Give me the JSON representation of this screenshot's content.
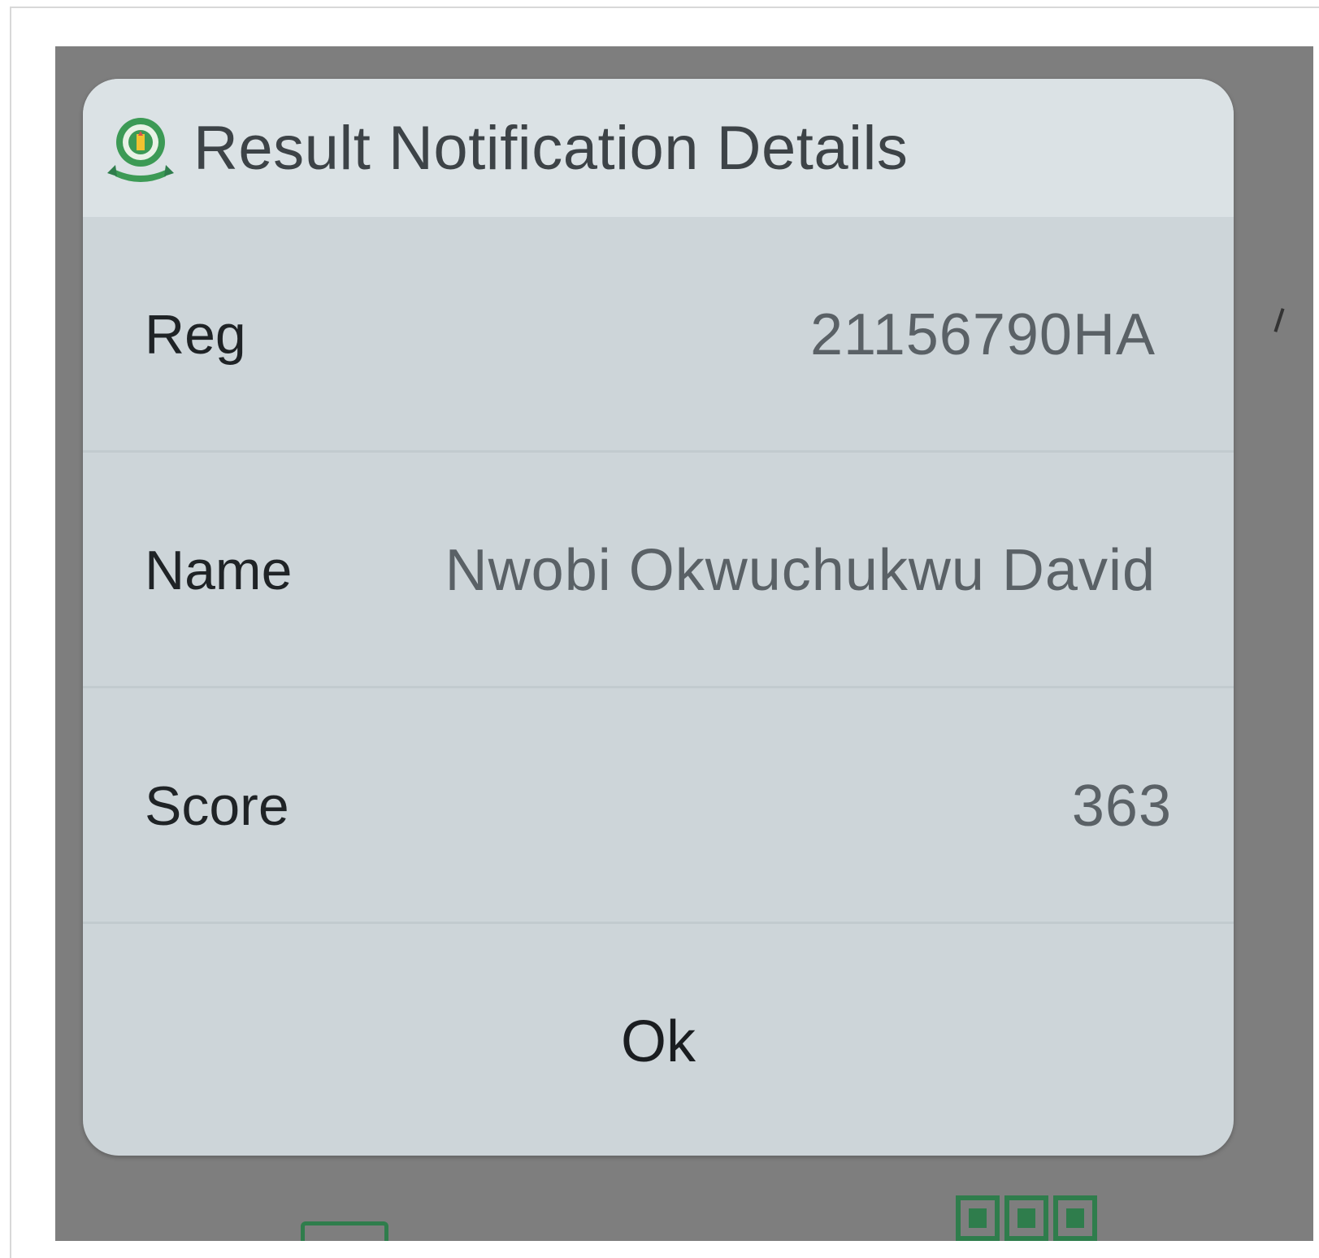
{
  "dialog": {
    "title": "Result Notification Details",
    "logo_icon": "jamb-logo-icon",
    "accent_color": "#2f7d4c",
    "rows": [
      {
        "label": "Reg",
        "value": "21156790HA"
      },
      {
        "label": "Name",
        "value": "Nwobi Okwuchukwu David"
      },
      {
        "label": "Score",
        "value": "363"
      }
    ],
    "ok_label": "Ok"
  }
}
